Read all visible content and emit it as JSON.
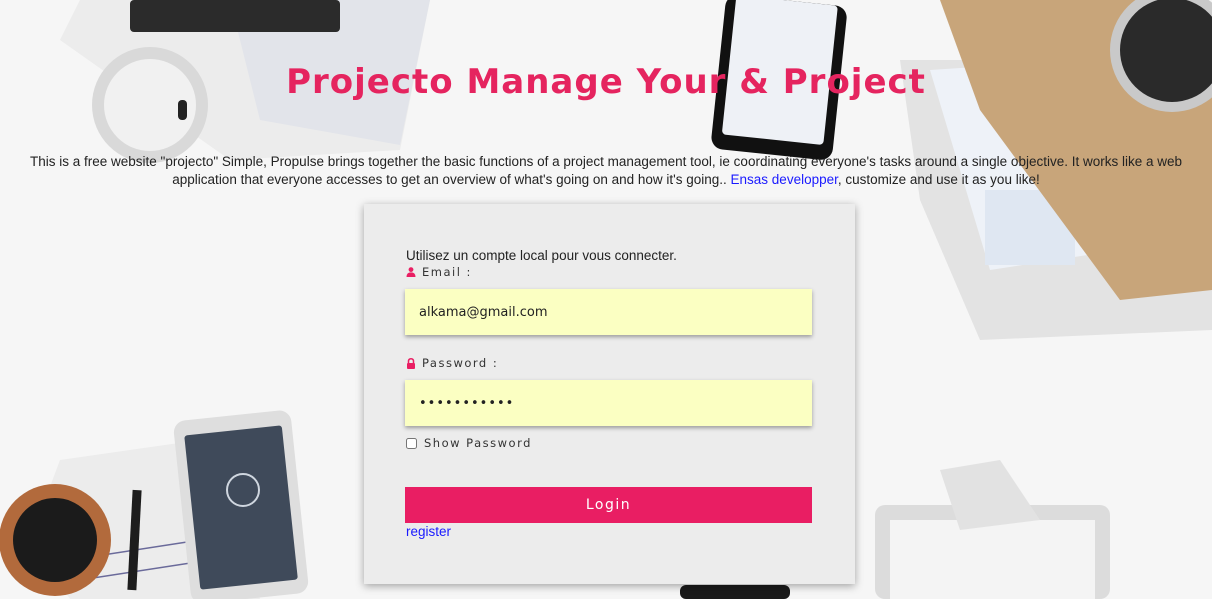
{
  "header": {
    "title": "Projecto Manage Your & Project"
  },
  "intro": {
    "text_before": "This is a free website \"projecto\" Simple, Propulse brings together the basic functions of a project management tool, ie coordinating everyone's tasks around a single objective. It works like a web application that everyone accesses to get an overview of what's going on and how it's going.. ",
    "link_text": "Ensas developper",
    "text_after": ", customize and use it as you like!"
  },
  "login": {
    "heading": "Utilisez un compte local pour vous connecter.",
    "email_label": "Email :",
    "email_value": "alkama@gmail.com",
    "password_label": "Password :",
    "password_value": "•••••••••••",
    "show_password_label": "Show Password",
    "login_label": "Login",
    "register_label": "register"
  },
  "icons": {
    "email": "user-icon",
    "password": "lock-icon"
  },
  "colors": {
    "accent": "#e91e63",
    "title": "#e5245f",
    "input_bg": "#fbffc2",
    "card_bg": "#ececec",
    "link": "#1a1aff"
  }
}
